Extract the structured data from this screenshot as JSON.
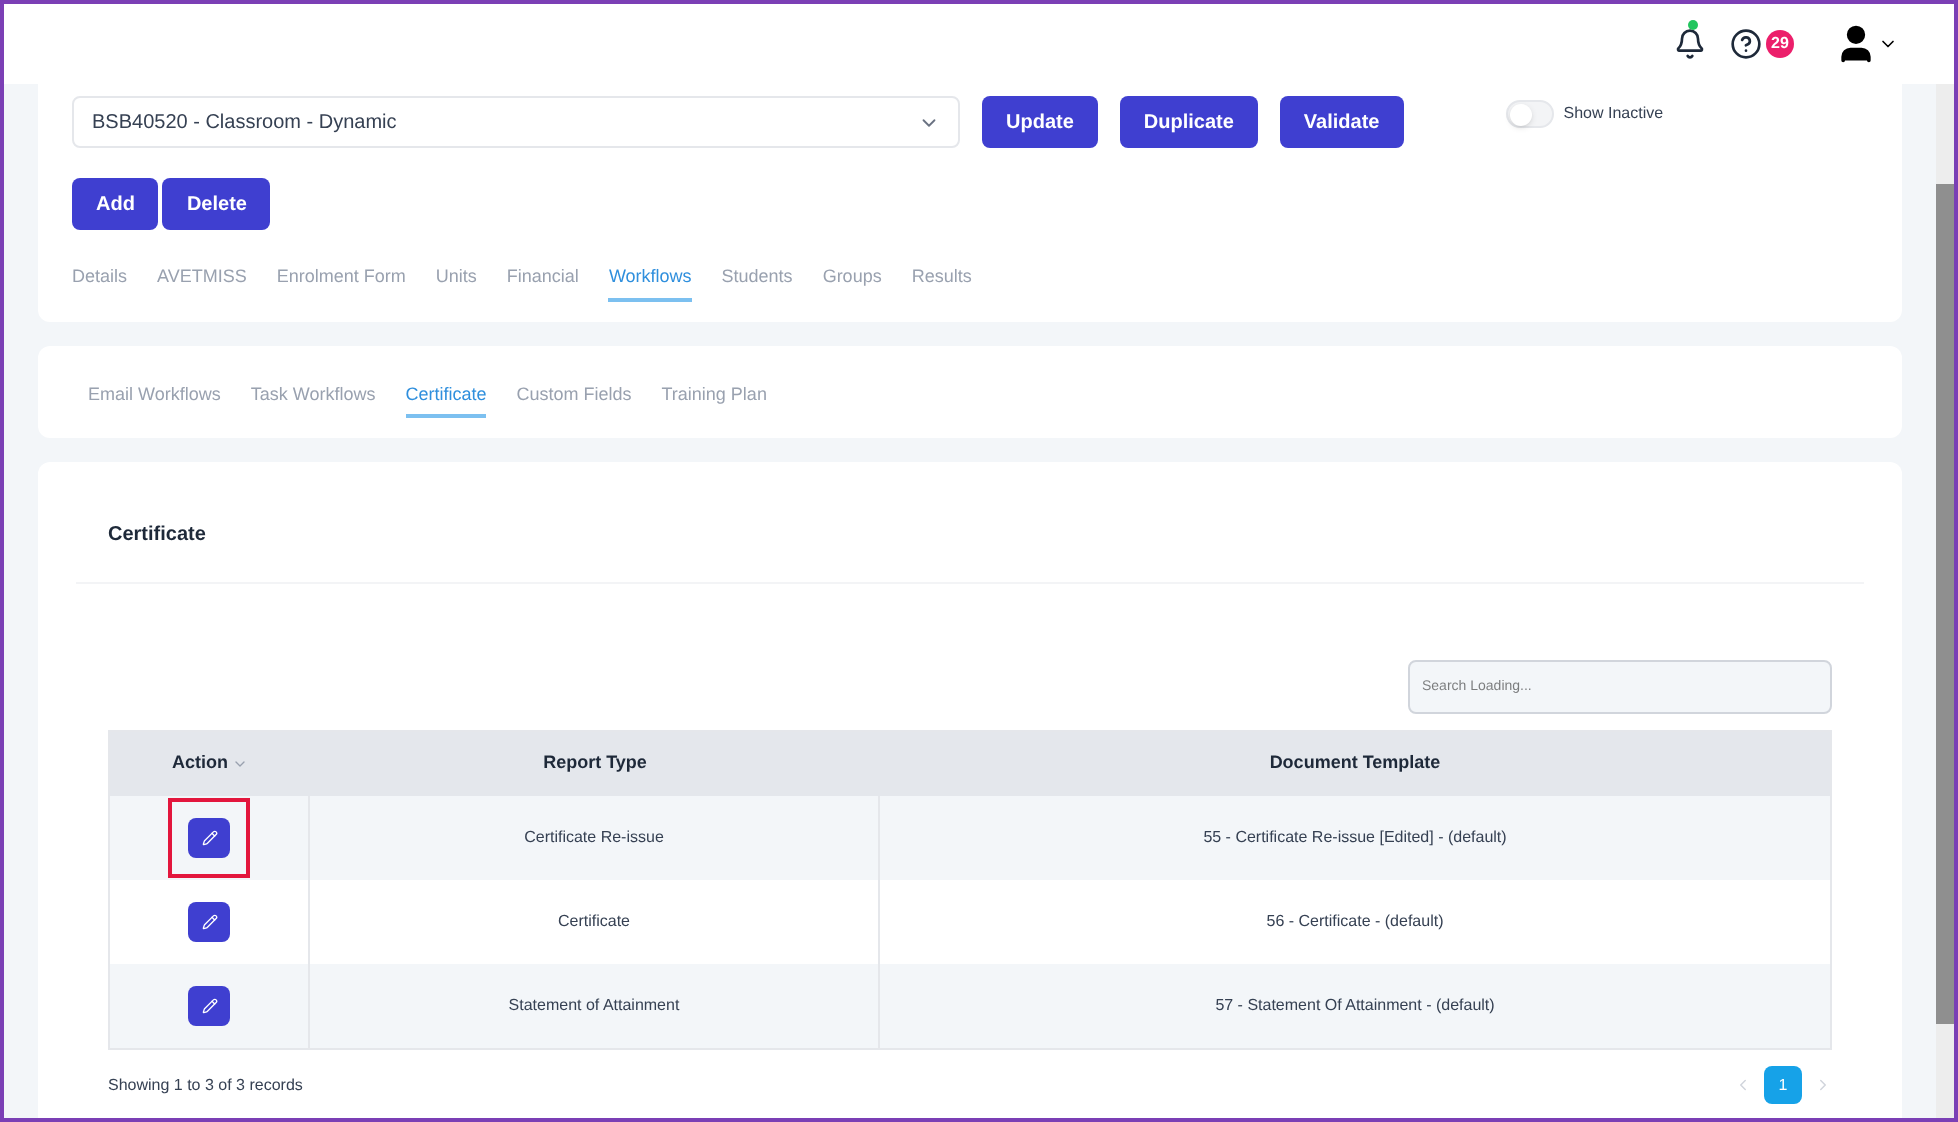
{
  "header": {
    "notification_dot": true,
    "help_badge": "29"
  },
  "course_select": {
    "value": "BSB40520 - Classroom - Dynamic"
  },
  "top_buttons": [
    "Update",
    "Duplicate",
    "Validate"
  ],
  "show_inactive": {
    "label": "Show Inactive",
    "on": false
  },
  "edit_buttons": [
    "Add",
    "Delete"
  ],
  "main_tabs": [
    {
      "label": "Details",
      "selected": false
    },
    {
      "label": "AVETMISS",
      "selected": false
    },
    {
      "label": "Enrolment Form",
      "selected": false
    },
    {
      "label": "Units",
      "selected": false
    },
    {
      "label": "Financial",
      "selected": false
    },
    {
      "label": "Workflows",
      "selected": true
    },
    {
      "label": "Students",
      "selected": false
    },
    {
      "label": "Groups",
      "selected": false
    },
    {
      "label": "Results",
      "selected": false
    }
  ],
  "sub_tabs": [
    {
      "label": "Email Workflows",
      "selected": false
    },
    {
      "label": "Task Workflows",
      "selected": false
    },
    {
      "label": "Certificate",
      "selected": true
    },
    {
      "label": "Custom Fields",
      "selected": false
    },
    {
      "label": "Training Plan",
      "selected": false
    }
  ],
  "panel_title": "Certificate",
  "search": {
    "placeholder": "Search Loading..."
  },
  "table": {
    "columns": [
      "Action",
      "Report Type",
      "Document Template"
    ],
    "rows": [
      {
        "report_type": "Certificate Re-issue",
        "document_template": "55 - Certificate Re-issue [Edited] - (default)",
        "highlighted": true
      },
      {
        "report_type": "Certificate",
        "document_template": "56 - Certificate - (default)",
        "highlighted": false
      },
      {
        "report_type": "Statement of Attainment",
        "document_template": "57 - Statement Of Attainment - (default)",
        "highlighted": false
      }
    ]
  },
  "footer": {
    "summary": "Showing 1 to 3 of 3 records",
    "pages": [
      {
        "label": "1",
        "selected": true
      }
    ]
  }
}
